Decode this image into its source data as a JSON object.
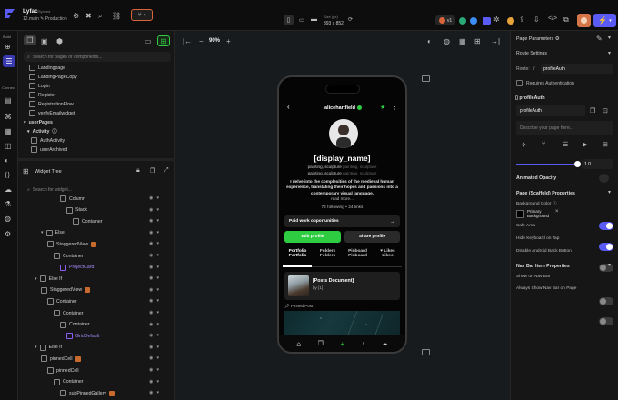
{
  "project": {
    "name": "Lyfac",
    "synced": "Synced",
    "branch": "12.main ✎ Production"
  },
  "toolbar": {
    "size_label": "Size (px)",
    "size_value": "393 x 852",
    "version_badge": "v1"
  },
  "left_rail": {
    "build": "Build",
    "connect": "Connect"
  },
  "pages_panel": {
    "search_placeholder": "Search for pages or components...",
    "pages": [
      "Landingpage",
      "LandingPageCopy",
      "Login",
      "Register",
      "RegistrationFlow",
      "verifyEmailwidget"
    ],
    "folder_user_pages": "userPages",
    "folder_activity": "Activity",
    "activity_pages": [
      "AuthActivity",
      "userArchived"
    ]
  },
  "widget_tree": {
    "title": "Widget Tree",
    "search_placeholder": "Search for widget...",
    "items": [
      {
        "label": "Column",
        "indent": 6
      },
      {
        "label": "Stack",
        "indent": 7
      },
      {
        "label": "Container",
        "indent": 8
      },
      {
        "label": "Else",
        "indent": 3
      },
      {
        "label": "StaggeredView",
        "indent": 4
      },
      {
        "label": "Container",
        "indent": 5
      },
      {
        "label": "ProjectCard",
        "indent": 6
      },
      {
        "label": "Else If",
        "indent": 2
      },
      {
        "label": "StaggeredView",
        "indent": 3
      },
      {
        "label": "Container",
        "indent": 4
      },
      {
        "label": "Container",
        "indent": 5
      },
      {
        "label": "Container",
        "indent": 6
      },
      {
        "label": "GridDefault",
        "indent": 7
      },
      {
        "label": "Else If",
        "indent": 2
      },
      {
        "label": "pinnedCell",
        "indent": 3
      },
      {
        "label": "pinnedCell",
        "indent": 4
      },
      {
        "label": "Container",
        "indent": 5
      },
      {
        "label": "subPinnedGallery",
        "indent": 6
      }
    ]
  },
  "canvas": {
    "zoom": "90%"
  },
  "phone": {
    "username": "alicehartfield",
    "display_name": "[display_name]",
    "tags_line1": "painting, sculpture",
    "tags_line1_faded": "painting, sculpture",
    "tags_line2": "painting, sculpture",
    "tags_line2_faded": "painting, sculpture",
    "bio": "I delve into the complexities of the medieval human experience, translating their hopes and passions into a contemporary visual language.",
    "read_more": "read more...",
    "stats": "72 following • 24 links",
    "paid_work": "Paid work opportunities",
    "edit_profile": "Edit profile",
    "share_profile": "Share profile",
    "tabs": [
      {
        "top": "Portfolio",
        "bottom": "Portfolio"
      },
      {
        "top": "Folders",
        "bottom": "Folders"
      },
      {
        "top": "Pinboard",
        "bottom": "Pinboard"
      },
      {
        "top": "Likes",
        "bottom": "Likes"
      }
    ],
    "post_title": "[Posts Document]",
    "post_by": "by [1]",
    "pinned_post": "Pinned Post"
  },
  "right_panel": {
    "page_params": "Page Parameters",
    "route_settings": "Route Settings",
    "route_label": "Route:",
    "route_value": "profileAuth",
    "requires_auth": "Requires Authentication",
    "page_name_label": "profileAuth",
    "page_name_value": "profileAuth",
    "describe_placeholder": "Describe your page here...",
    "slider_value": "1.0",
    "animated_opacity": "Animated Opacity",
    "page_props": "Page (Scaffold) Properties",
    "bg_color": "Background Color",
    "bg_color_value_line1": "Primary",
    "bg_color_value_line2": "Background",
    "safe_area": "Safe Area",
    "hide_keyboard": "Hide Keyboard on Tap",
    "disable_back": "Disable Android Back Button",
    "nav_bar_props": "Nav Bar Item Properties",
    "show_nav": "Show on Nav Bar",
    "always_show_nav": "Always Show Nav Bar on Page"
  },
  "colors": {
    "accent": "#5a5af5",
    "green": "#2ecc40",
    "tag_orange": "#c86a2e",
    "purple": "#8b5cf6"
  }
}
